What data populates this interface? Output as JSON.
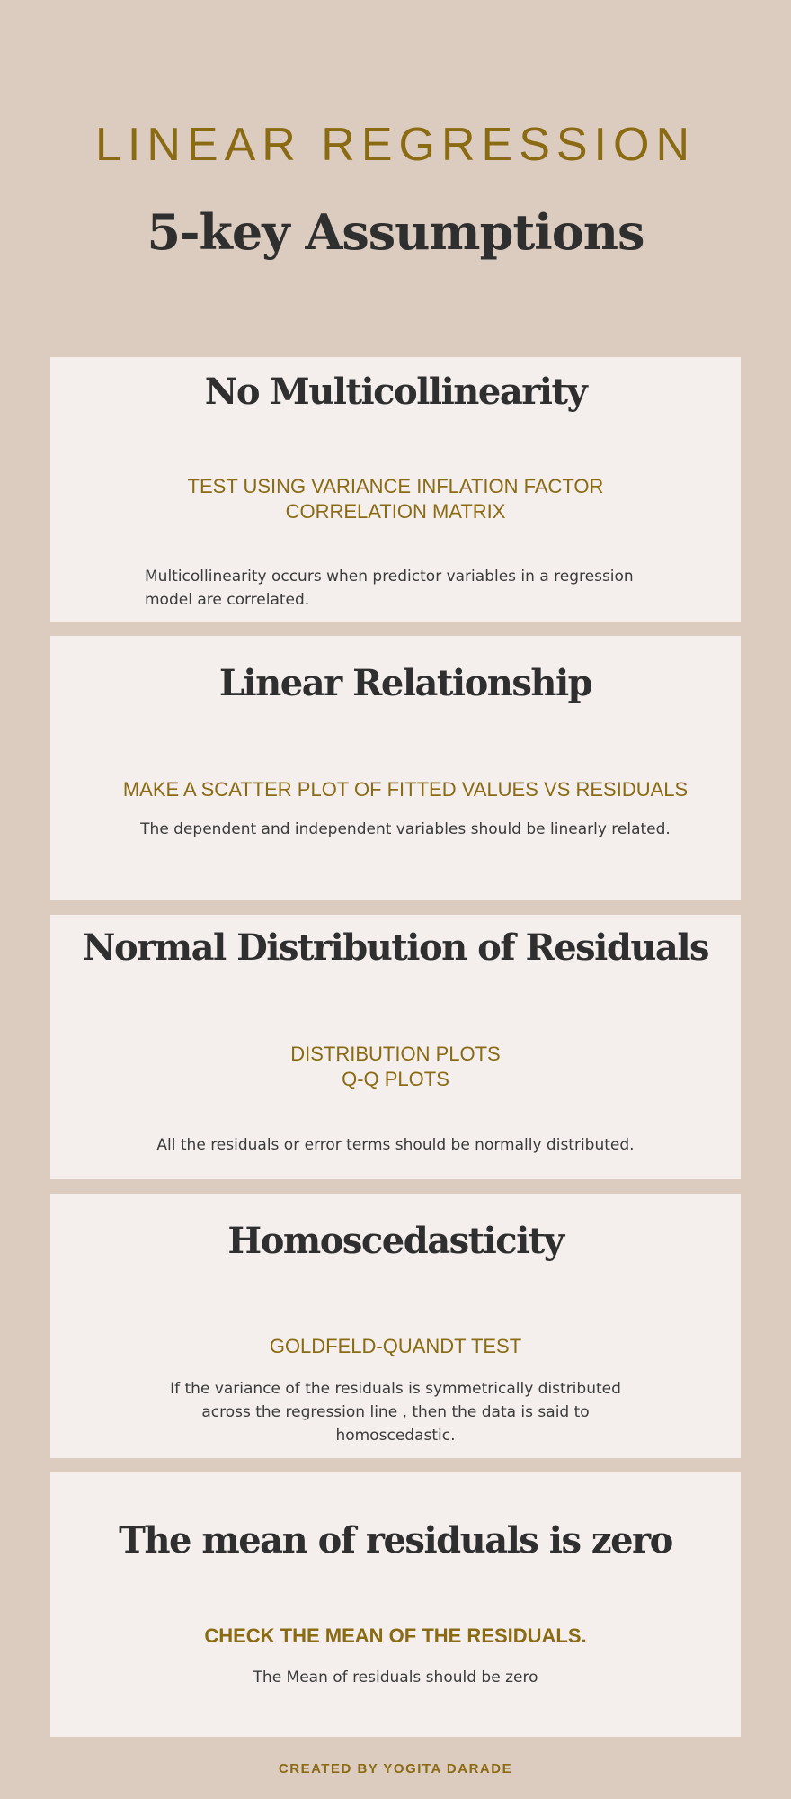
{
  "header": {
    "kicker": "LINEAR REGRESSION",
    "title": "5-key Assumptions"
  },
  "cards": [
    {
      "title": "No Multicollinearity",
      "method_lines": [
        "TEST USING VARIANCE INFLATION FACTOR",
        "CORRELATION MATRIX"
      ],
      "description": "Multicollinearity occurs when predictor variables in a regression model are correlated."
    },
    {
      "title": "Linear Relationship",
      "method_lines": [
        "MAKE A SCATTER PLOT OF FITTED VALUES VS RESIDUALS"
      ],
      "description": "The dependent and independent variables should be linearly related."
    },
    {
      "title": "Normal Distribution of Residuals",
      "method_lines": [
        "DISTRIBUTION PLOTS",
        "Q-Q PLOTS"
      ],
      "description": "All the residuals or error terms should be normally distributed."
    },
    {
      "title": "Homoscedasticity",
      "method_lines": [
        "GOLDFELD-QUANDT TEST"
      ],
      "description": "If the variance of the residuals is symmetrically distributed across the regression line , then the data is said to homoscedastic."
    },
    {
      "title": "The mean of residuals is zero",
      "method_lines": [
        "CHECK THE MEAN OF THE RESIDUALS."
      ],
      "description": "The Mean of residuals should be zero"
    }
  ],
  "footer": {
    "credit": "CREATED BY YOGITA DARADE"
  },
  "colors": {
    "page_background": "#dccbbf",
    "card_background": "#f4efed",
    "accent_gold": "#8a6a12",
    "heading_dark": "#2f2f2f"
  }
}
